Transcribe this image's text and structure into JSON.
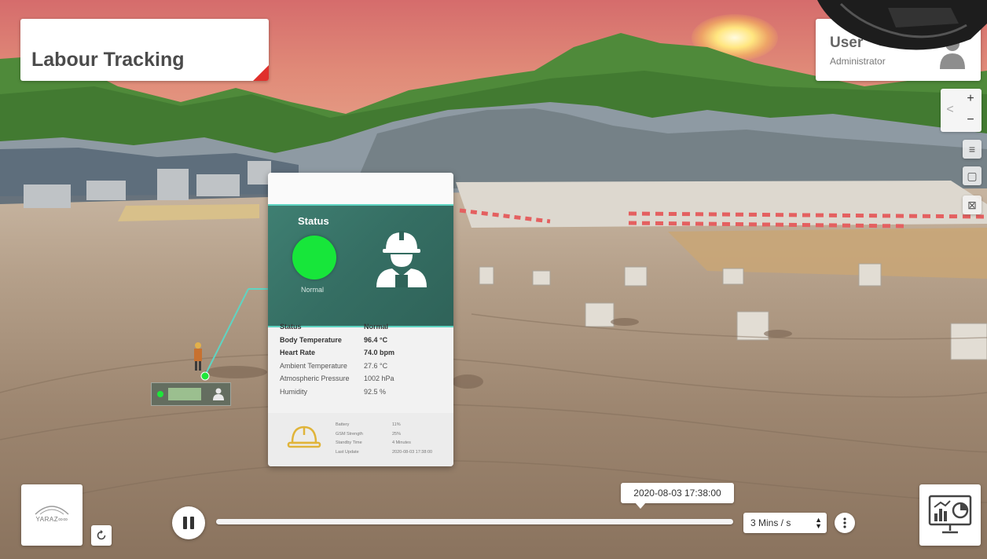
{
  "app": {
    "title": "Labour Tracking"
  },
  "user": {
    "name": "User",
    "role": "Administrator"
  },
  "map_controls": {
    "zoom_in": "+",
    "zoom_out": "−",
    "collapse": "<"
  },
  "card": {
    "hero_status_label": "Status",
    "hero_status_value": "Normal",
    "status_color": "#17e63a",
    "details": [
      {
        "label": "Status",
        "value": "Normal"
      },
      {
        "label": "Body Temperature",
        "value": "96.4 °C"
      },
      {
        "label": "Heart Rate",
        "value": "74.0 bpm"
      },
      {
        "label": "Ambient Temperature",
        "value": "27.6 °C"
      },
      {
        "label": "Atmospheric Pressure",
        "value": "1002 hPa"
      },
      {
        "label": "Humidity",
        "value": "92.5 %"
      }
    ],
    "device": [
      {
        "label": "Battery",
        "value": "11%"
      },
      {
        "label": "GSM Strength",
        "value": "25%"
      },
      {
        "label": "Standby Time",
        "value": "4 Minutes"
      },
      {
        "label": "Last Update",
        "value": "2020-08-03 17:38:00"
      }
    ]
  },
  "playback": {
    "timestamp": "2020-08-03 17:38:00",
    "speed": "3 Mins / s"
  },
  "logo": {
    "text": "YARAZ∞∞"
  },
  "icons": {
    "avatar": "user-avatar-icon",
    "worker": "worker-helmet-icon",
    "helmet": "hard-hat-icon",
    "pause": "pause-icon",
    "reset": "reset-icon",
    "more": "more-vertical-icon",
    "dashboard": "dashboard-icon"
  }
}
